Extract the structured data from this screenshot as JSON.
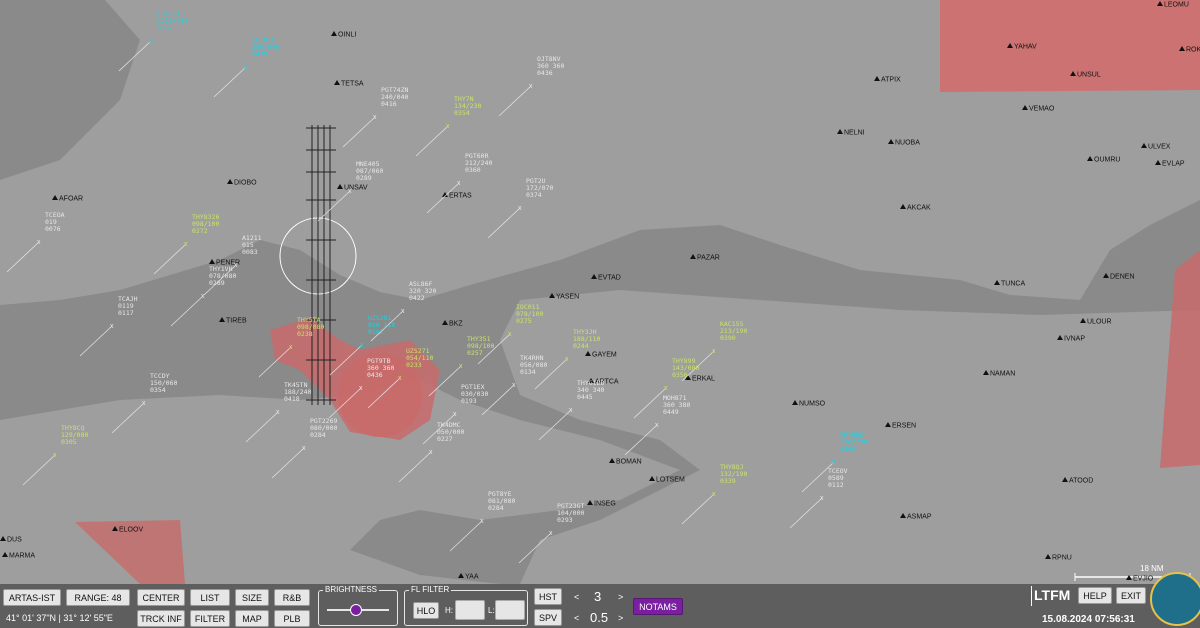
{
  "colors": {
    "sea": "#8a8a8a",
    "land": "#9e9e9e",
    "zone": "#c86a6a",
    "zone_top": "#d36a6a",
    "track_cyan": "#1fd0e0",
    "track_yellow": "#c9e26a",
    "track_grey": "#e6e6e6",
    "notams": "#7a1fa0"
  },
  "waypoints": [
    {
      "name": "OINLI"
    },
    {
      "name": "TETSA"
    },
    {
      "name": "UNSAV"
    },
    {
      "name": "ERTAS"
    },
    {
      "name": "DIOBO"
    },
    {
      "name": "AFOAR"
    },
    {
      "name": "PENER"
    },
    {
      "name": "TIREB"
    },
    {
      "name": "BKZ"
    },
    {
      "name": "YASEN"
    },
    {
      "name": "EVTAD"
    },
    {
      "name": "PAZAR"
    },
    {
      "name": "GAYEM"
    },
    {
      "name": "ARTCA"
    },
    {
      "name": "ERKAL"
    },
    {
      "name": "NUMSO"
    },
    {
      "name": "ERSEN"
    },
    {
      "name": "ATOOD"
    },
    {
      "name": "ASMAP"
    },
    {
      "name": "RPNU"
    },
    {
      "name": "EVJIO"
    },
    {
      "name": "NAMAN"
    },
    {
      "name": "ULOUR"
    },
    {
      "name": "IVNAP"
    },
    {
      "name": "DENEN"
    },
    {
      "name": "TUNCA"
    },
    {
      "name": "AKCAK"
    },
    {
      "name": "NUOBA"
    },
    {
      "name": "NELNI"
    },
    {
      "name": "OUMRU"
    },
    {
      "name": "EVLAP"
    },
    {
      "name": "ULVEX"
    },
    {
      "name": "VEMAO"
    },
    {
      "name": "UNSUL"
    },
    {
      "name": "YAHAV"
    },
    {
      "name": "ATPIX"
    },
    {
      "name": "LEOMU"
    },
    {
      "name": "ROKV"
    },
    {
      "name": "ELOOV"
    },
    {
      "name": "MARMA"
    },
    {
      "name": "YAA"
    },
    {
      "name": "INSEG"
    },
    {
      "name": "LOTSEM"
    },
    {
      "name": "BOMAN"
    },
    {
      "name": "DUS"
    }
  ],
  "tracks": [
    {
      "lines": [
        "THY8CI",
        "1920/080",
        "0387"
      ],
      "color": "cyan"
    },
    {
      "lines": [
        "PGT81C",
        "250/040",
        "0439"
      ],
      "color": "cyan"
    },
    {
      "lines": [
        "PGT74ZN",
        "240/040",
        "0416"
      ],
      "color": "grey"
    },
    {
      "lines": [
        "THY7N",
        "134/230",
        "0354"
      ],
      "color": "yellow"
    },
    {
      "lines": [
        "OJT8NV",
        "360 360",
        "0436"
      ],
      "color": "grey"
    },
    {
      "lines": [
        "PGT60R",
        "212/240",
        "0360"
      ],
      "color": "grey"
    },
    {
      "lines": [
        "PGT2U",
        "172/070",
        "0374"
      ],
      "color": "grey"
    },
    {
      "lines": [
        "MNE405",
        "087/060",
        "0289"
      ],
      "color": "grey"
    },
    {
      "lines": [
        "TCEOA",
        "019",
        "0076"
      ],
      "color": "grey"
    },
    {
      "lines": [
        "THY8326",
        "098/100",
        "0272"
      ],
      "color": "yellow"
    },
    {
      "lines": [
        "A1211",
        "015",
        "0083"
      ],
      "color": "grey"
    },
    {
      "lines": [
        "THY1VH",
        "078/080",
        "0289"
      ],
      "color": "grey"
    },
    {
      "lines": [
        "TCAJH",
        "0119",
        "0117"
      ],
      "color": "grey"
    },
    {
      "lines": [
        "THY5TA",
        "098/080",
        "0238"
      ],
      "color": "yellow"
    },
    {
      "lines": [
        "UZS201",
        "038 110",
        "0182"
      ],
      "color": "cyan"
    },
    {
      "lines": [
        "ASL86F",
        "320 320",
        "0422"
      ],
      "color": "grey"
    },
    {
      "lines": [
        "IOC011",
        "078/100",
        "0275"
      ],
      "color": "yellow"
    },
    {
      "lines": [
        "THY3JH",
        "188/110",
        "0244"
      ],
      "color": "yellow"
    },
    {
      "lines": [
        "KAC155",
        "213/190",
        "0390"
      ],
      "color": "yellow"
    },
    {
      "lines": [
        "THY351",
        "098/100",
        "0257"
      ],
      "color": "yellow"
    },
    {
      "lines": [
        "TK4RHN",
        "056/080",
        "0134"
      ],
      "color": "grey"
    },
    {
      "lines": [
        "PGT9TB",
        "360 360",
        "0436"
      ],
      "color": "grey"
    },
    {
      "lines": [
        "UZS271",
        "054/110",
        "0233"
      ],
      "color": "yellow"
    },
    {
      "lines": [
        "THY899",
        "143/080",
        "0356"
      ],
      "color": "yellow"
    },
    {
      "lines": [
        "MOH871",
        "360 380",
        "0449"
      ],
      "color": "grey"
    },
    {
      "lines": [
        "THYG1DD",
        "340 340",
        "0445"
      ],
      "color": "grey"
    },
    {
      "lines": [
        "PGT1EX",
        "030/030",
        "0193"
      ],
      "color": "grey"
    },
    {
      "lines": [
        "TCCDY",
        "150/060",
        "0354"
      ],
      "color": "grey"
    },
    {
      "lines": [
        "TK45TN",
        "188/240",
        "0418"
      ],
      "color": "grey"
    },
    {
      "lines": [
        "PGT2269",
        "080/000",
        "0284"
      ],
      "color": "grey"
    },
    {
      "lines": [
        "THY8CQ",
        "129/080",
        "0305"
      ],
      "color": "yellow"
    },
    {
      "lines": [
        "THY5RS",
        "230/230",
        "0409"
      ],
      "color": "cyan"
    },
    {
      "lines": [
        "THY8QJ",
        "132/190",
        "0339"
      ],
      "color": "yellow"
    },
    {
      "lines": [
        "TCEOV",
        "0589",
        "0112"
      ],
      "color": "grey"
    },
    {
      "lines": [
        "PGT8YE",
        "081/080",
        "0284"
      ],
      "color": "grey"
    },
    {
      "lines": [
        "PGT23GT",
        "104/000",
        "0293"
      ],
      "color": "grey"
    },
    {
      "lines": [
        "TK4DMC",
        "050/000",
        "0227"
      ],
      "color": "grey"
    }
  ],
  "toolbar": {
    "sector": "ARTAS-IST",
    "range": "RANGE: 48",
    "coords": "41° 01' 37\"N | 31° 12' 55\"E",
    "center": "CENTER",
    "list": "LIST",
    "size": "SIZE",
    "rb": "R&B",
    "trck_inf": "TRCK INF",
    "filter": "FILTER",
    "map": "MAP",
    "plb": "PLB",
    "brightness": "BRIGHTNESS",
    "brightness_level": 0.45,
    "fl_filter": "FL FILTER",
    "hlo": "HLO",
    "h": "H:",
    "l": "L:",
    "hst": "HST",
    "spv": "SPV",
    "hst_val": "3",
    "spv_val": "0.5",
    "prev": "<",
    "next": ">",
    "notams": "NOTAMS",
    "airport": "LTFM",
    "help": "HELP",
    "exit": "EXIT",
    "datetime": "15.08.2024 07:56:31",
    "scale": "18 NM"
  }
}
